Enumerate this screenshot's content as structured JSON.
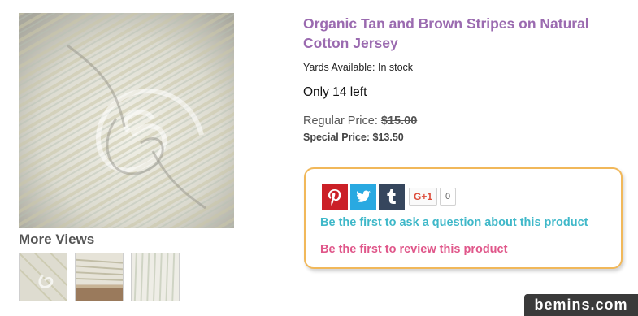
{
  "product": {
    "title": "Organic Tan and Brown Stripes on Natural Cotton Jersey",
    "availability_label": "Yards Available:",
    "availability_value": "In stock",
    "stock_left": "Only 14 left",
    "regular_price_label": "Regular Price:",
    "regular_price": "$15.00",
    "special_price_label": "Special Price:",
    "special_price": "$13.50"
  },
  "gallery": {
    "more_views_label": "More Views",
    "thumbnail_count": 3
  },
  "share": {
    "icons": [
      "pinterest-icon",
      "twitter-icon",
      "tumblr-icon"
    ],
    "gplus_label": "G+1",
    "gplus_count": "0",
    "ask_question": "Be the first to ask a question about this product",
    "review": "Be the first to review this product"
  },
  "colors": {
    "title": "#9b6bb0",
    "ask_link": "#3fb8c9",
    "review_link": "#e0578a",
    "box_border": "#f1b85a",
    "pinterest": "#cb2027",
    "twitter": "#29a9e1",
    "tumblr": "#36465d"
  },
  "watermark": {
    "text": "bemins.com"
  }
}
